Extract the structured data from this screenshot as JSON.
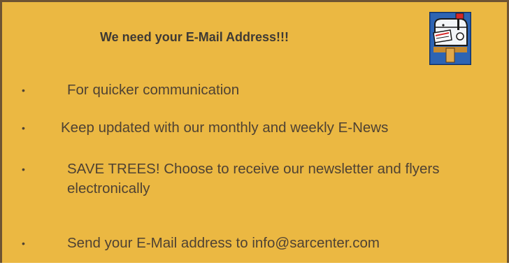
{
  "heading": "We need your E-Mail Address!!!",
  "icons": {
    "mailbox": "mailbox-icon"
  },
  "colors": {
    "background": "#EBB842",
    "border": "#6E5433",
    "text": "#4F4233"
  },
  "items": [
    {
      "text": "For quicker communication"
    },
    {
      "text": "Keep updated with our monthly and weekly E-News"
    },
    {
      "text": "SAVE TREES! Choose to receive our newsletter and flyers electronically"
    },
    {
      "text": "Send your E-Mail address to info@sarcenter.com"
    }
  ]
}
